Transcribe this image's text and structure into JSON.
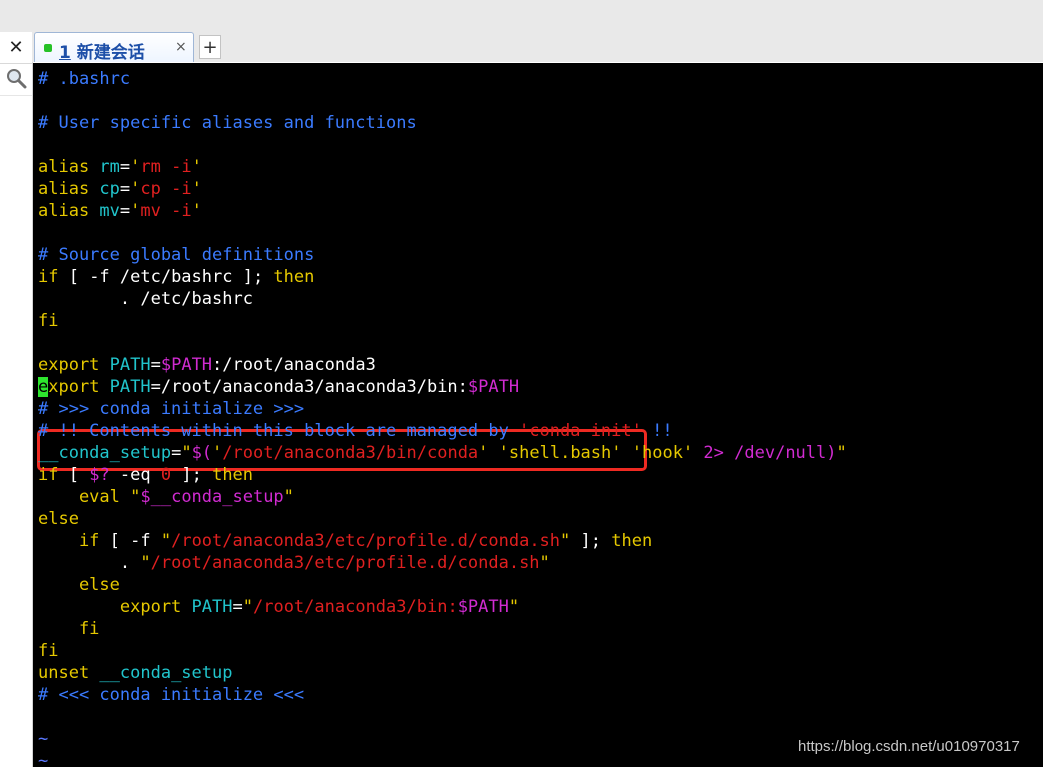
{
  "tab": {
    "number": "1",
    "title": "新建会话",
    "close_glyph": "×",
    "add_glyph": "+"
  },
  "rail": {
    "close_glyph": "✕"
  },
  "terminal_lines": [
    [
      [
        "# .bashrc",
        "blue"
      ]
    ],
    [],
    [
      [
        "# User specific aliases and functions",
        "blue"
      ]
    ],
    [],
    [
      [
        "alias ",
        "yel"
      ],
      [
        "rm",
        "cyan"
      ],
      [
        "=",
        "white"
      ],
      [
        "'",
        "yel"
      ],
      [
        "rm -i",
        "red"
      ],
      [
        "'",
        "yel"
      ]
    ],
    [
      [
        "alias ",
        "yel"
      ],
      [
        "cp",
        "cyan"
      ],
      [
        "=",
        "white"
      ],
      [
        "'",
        "yel"
      ],
      [
        "cp -i",
        "red"
      ],
      [
        "'",
        "yel"
      ]
    ],
    [
      [
        "alias ",
        "yel"
      ],
      [
        "mv",
        "cyan"
      ],
      [
        "=",
        "white"
      ],
      [
        "'",
        "yel"
      ],
      [
        "mv -i",
        "red"
      ],
      [
        "'",
        "yel"
      ]
    ],
    [],
    [
      [
        "# Source global definitions",
        "blue"
      ]
    ],
    [
      [
        "if",
        "yel"
      ],
      [
        " [ -f /etc/bashrc ]; ",
        "white"
      ],
      [
        "then",
        "yel"
      ]
    ],
    [
      [
        "        . /etc/bashrc",
        "white"
      ]
    ],
    [
      [
        "fi",
        "yel"
      ]
    ],
    [],
    [
      [
        "export ",
        "yel"
      ],
      [
        "PATH",
        "cyan"
      ],
      [
        "=",
        "white"
      ],
      [
        "$PATH",
        "mag"
      ],
      [
        ":/root/anaconda3",
        "white"
      ]
    ],
    [
      [
        "e",
        "cursor"
      ],
      [
        "xport ",
        "yel"
      ],
      [
        "PATH",
        "cyan"
      ],
      [
        "=/root/anaconda3/anaconda3/bin:",
        "white"
      ],
      [
        "$PATH",
        "mag"
      ]
    ],
    [
      [
        "# >>> conda initialize >>>",
        "blue"
      ]
    ],
    [
      [
        "# !! Contents within this block are managed by ",
        "blue"
      ],
      [
        "'conda init'",
        "red"
      ],
      [
        " !!",
        "blue"
      ]
    ],
    [
      [
        "__conda_setup",
        "cyan"
      ],
      [
        "=",
        "white"
      ],
      [
        "\"",
        "yel"
      ],
      [
        "$(",
        "mag"
      ],
      [
        "'",
        "yel"
      ],
      [
        "/root/anaconda3/bin/conda",
        "red"
      ],
      [
        "'",
        "yel"
      ],
      [
        " ",
        "white"
      ],
      [
        "'shell.bash'",
        "yel"
      ],
      [
        " ",
        "white"
      ],
      [
        "'hook'",
        "yel"
      ],
      [
        " ",
        "white"
      ],
      [
        "2>",
        "mag"
      ],
      [
        " /dev/null",
        "mag"
      ],
      [
        ")",
        "mag"
      ],
      [
        "\"",
        "yel"
      ]
    ],
    [
      [
        "if",
        "yel"
      ],
      [
        " [ ",
        "white"
      ],
      [
        "$?",
        "mag"
      ],
      [
        " -eq ",
        "white"
      ],
      [
        "0",
        "red"
      ],
      [
        " ]; ",
        "white"
      ],
      [
        "then",
        "yel"
      ]
    ],
    [
      [
        "    eval ",
        "yel"
      ],
      [
        "\"",
        "yel"
      ],
      [
        "$__conda_setup",
        "mag"
      ],
      [
        "\"",
        "yel"
      ]
    ],
    [
      [
        "else",
        "yel"
      ]
    ],
    [
      [
        "    if",
        "yel"
      ],
      [
        " [ -f ",
        "white"
      ],
      [
        "\"",
        "yel"
      ],
      [
        "/root/anaconda3/etc/profile.d/conda.sh",
        "red"
      ],
      [
        "\"",
        "yel"
      ],
      [
        " ]; ",
        "white"
      ],
      [
        "then",
        "yel"
      ]
    ],
    [
      [
        "        . ",
        "white"
      ],
      [
        "\"",
        "yel"
      ],
      [
        "/root/anaconda3/etc/profile.d/conda.sh",
        "red"
      ],
      [
        "\"",
        "yel"
      ]
    ],
    [
      [
        "    else",
        "yel"
      ]
    ],
    [
      [
        "        export ",
        "yel"
      ],
      [
        "PATH",
        "cyan"
      ],
      [
        "=",
        "white"
      ],
      [
        "\"",
        "yel"
      ],
      [
        "/root/anaconda3/bin:",
        "red"
      ],
      [
        "$PATH",
        "mag"
      ],
      [
        "\"",
        "yel"
      ]
    ],
    [
      [
        "    fi",
        "yel"
      ]
    ],
    [
      [
        "fi",
        "yel"
      ]
    ],
    [
      [
        "unset ",
        "yel"
      ],
      [
        "__conda_setup",
        "cyan"
      ]
    ],
    [
      [
        "# <<< conda initialize <<<",
        "blue"
      ]
    ],
    [],
    [
      [
        "~",
        "tilde"
      ]
    ],
    [
      [
        "~",
        "tilde"
      ]
    ]
  ],
  "watermark": "https://blog.csdn.net/u010970317"
}
